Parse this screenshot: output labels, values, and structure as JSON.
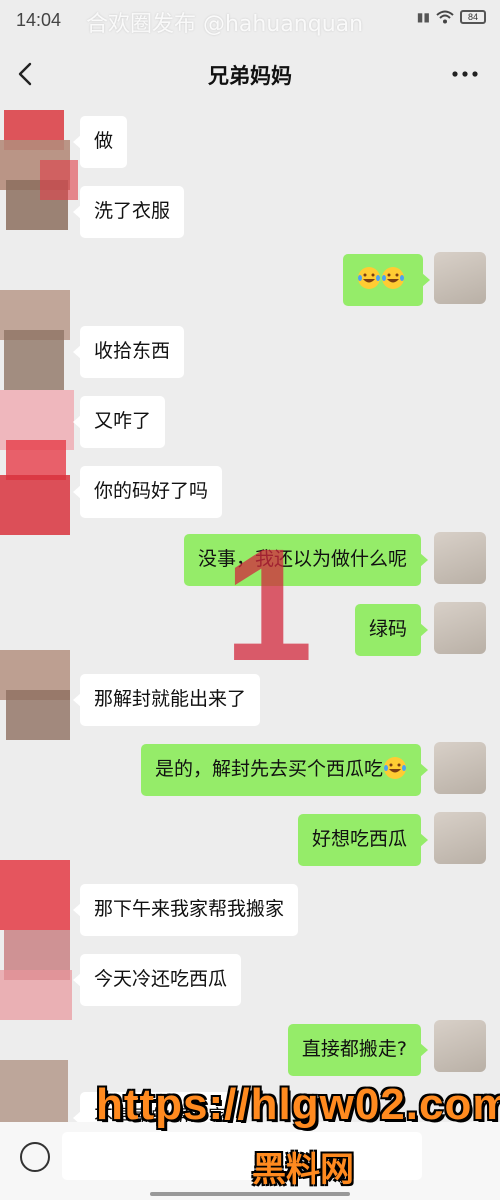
{
  "status_bar": {
    "time": "14:04",
    "watermark": "合欢圈发布  @hahuanquan",
    "battery": "84"
  },
  "nav": {
    "title": "兄弟妈妈",
    "back_icon": "chevron-left-icon",
    "more_icon": "more-dots-icon"
  },
  "messages": [
    {
      "side": "left",
      "text": "做"
    },
    {
      "side": "left",
      "text": "洗了衣服"
    },
    {
      "side": "right",
      "text": "",
      "emojis": 2
    },
    {
      "side": "left",
      "text": "收拾东西"
    },
    {
      "side": "left",
      "text": "又咋了"
    },
    {
      "side": "left",
      "text": "你的码好了吗"
    },
    {
      "side": "right",
      "text": "没事，我还以为做什么呢"
    },
    {
      "side": "right",
      "text": "绿码"
    },
    {
      "side": "left",
      "text": "那解封就能出来了"
    },
    {
      "side": "right",
      "text": "是的，解封先去买个西瓜吃",
      "emojis": 1
    },
    {
      "side": "right",
      "text": "好想吃西瓜"
    },
    {
      "side": "left",
      "text": "那下午来我家帮我搬家"
    },
    {
      "side": "left",
      "text": "今天冷还吃西瓜"
    },
    {
      "side": "right",
      "text": "直接都搬走?"
    },
    {
      "side": "left",
      "text": "不是寄的朋友家"
    }
  ],
  "overlay_mark": "1",
  "watermark_bottom": {
    "url": "https://hlgw02.com",
    "label": "黑料网"
  },
  "colors": {
    "background": "#ededed",
    "bubble_self": "#95ec69",
    "bubble_other": "#ffffff"
  }
}
